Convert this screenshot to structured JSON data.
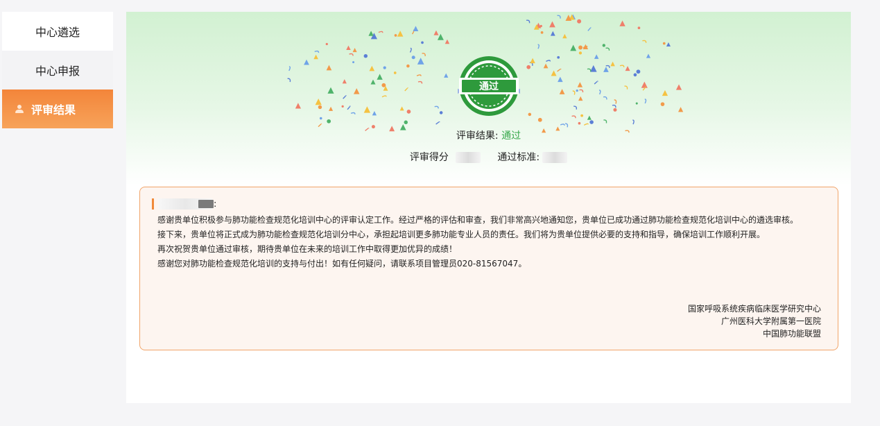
{
  "sidebar": {
    "items": [
      {
        "label": "中心遴选"
      },
      {
        "label": "中心申报"
      },
      {
        "label": "评审结果",
        "icon": "user-icon",
        "active": true
      }
    ]
  },
  "result": {
    "seal_text": "通过",
    "result_label": "评审结果:",
    "result_value": "通过",
    "score_label": "评审得分",
    "standard_label": "通过标准:"
  },
  "notice": {
    "paragraphs": [
      "感谢贵单位积极参与肺功能检查规范化培训中心的评审认定工作。经过严格的评估和审查，我们非常高兴地通知您，贵单位已成功通过肺功能检查规范化培训中心的遴选审核。",
      "接下来，贵单位将正式成为肺功能检查规范化培训分中心，承担起培训更多肺功能专业人员的责任。我们将为贵单位提供必要的支持和指导，确保培训工作顺利开展。",
      "再次祝贺贵单位通过审核，期待贵单位在未来的培训工作中取得更加优异的成绩！",
      "感谢您对肺功能检查规范化培训的支持与付出！如有任何疑问，请联系项目管理员020-81567047。"
    ],
    "signature": [
      "国家呼吸系统疾病临床医学研究中心",
      "广州医科大学附属第一医院",
      "中国肺功能联盟"
    ]
  },
  "colors": {
    "accent_orange": "#f3853a",
    "pass_green": "#36a84a",
    "seal_green": "#2e9a3c"
  }
}
